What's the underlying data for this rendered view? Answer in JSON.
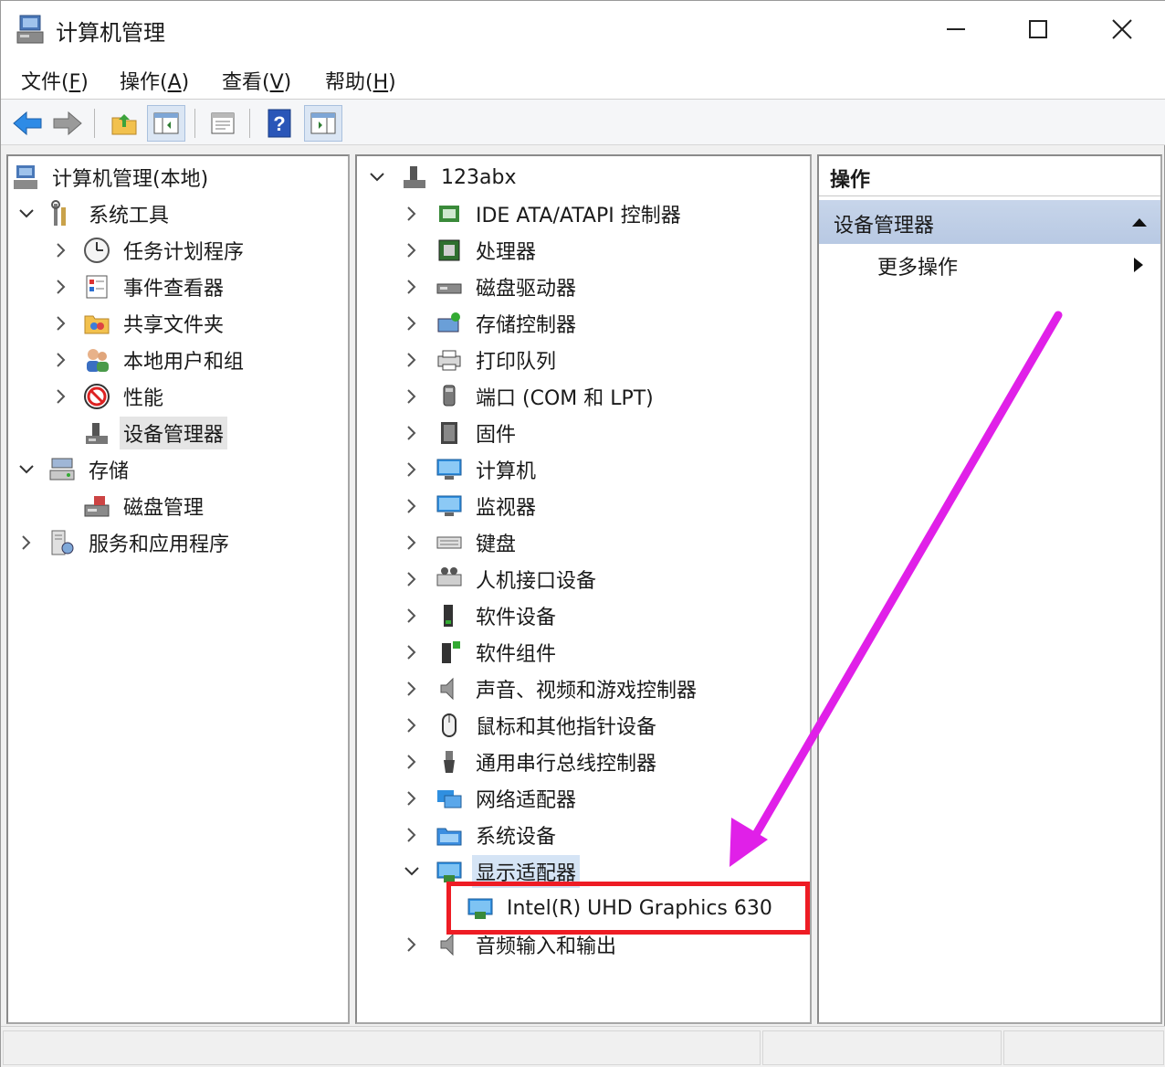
{
  "window": {
    "title": "计算机管理"
  },
  "menu": [
    {
      "label": "文件(",
      "key": "F",
      "end": ")"
    },
    {
      "label": "操作(",
      "key": "A",
      "end": ")"
    },
    {
      "label": "查看(",
      "key": "V",
      "end": ")"
    },
    {
      "label": "帮助(",
      "key": "H",
      "end": ")"
    }
  ],
  "toolbar": {
    "icons": [
      "back-arrow-icon",
      "forward-arrow-icon",
      "up-folder-icon",
      "show-hide-console-tree-icon",
      "properties-icon",
      "help-icon",
      "show-hide-action-pane-icon"
    ]
  },
  "left_tree": {
    "root": "计算机管理(本地)",
    "system_tools": "系统工具",
    "task_scheduler": "任务计划程序",
    "event_viewer": "事件查看器",
    "shared_folders": "共享文件夹",
    "local_users": "本地用户和组",
    "performance": "性能",
    "device_manager": "设备管理器",
    "storage": "存储",
    "disk_management": "磁盘管理",
    "services_apps": "服务和应用程序"
  },
  "device_tree": {
    "computer_name": "123abx",
    "categories": [
      "IDE ATA/ATAPI 控制器",
      "处理器",
      "磁盘驱动器",
      "存储控制器",
      "打印队列",
      "端口 (COM 和 LPT)",
      "固件",
      "计算机",
      "监视器",
      "键盘",
      "人机接口设备",
      "软件设备",
      "软件组件",
      "声音、视频和游戏控制器",
      "鼠标和其他指针设备",
      "通用串行总线控制器",
      "网络适配器",
      "系统设备",
      "显示适配器"
    ],
    "display_adapter_child": "Intel(R) UHD Graphics 630",
    "audio_io": "音频输入和输出"
  },
  "actions_pane": {
    "header": "操作",
    "section": "设备管理器",
    "more_actions": "更多操作"
  },
  "colors": {
    "annotation_box": "#ee1c24",
    "annotation_arrow": "#e020e8",
    "section_bg": "#c1d1e8"
  }
}
